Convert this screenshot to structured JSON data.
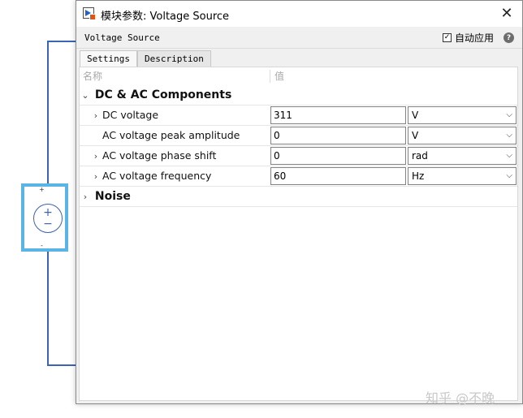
{
  "window": {
    "title": "模块参数: Voltage Source",
    "close_icon": "✕"
  },
  "block": {
    "name": "Voltage Source",
    "auto_apply_label": "自动应用",
    "auto_apply_checked": true
  },
  "tabs": [
    {
      "label": "Settings",
      "active": true
    },
    {
      "label": "Description",
      "active": false
    }
  ],
  "table": {
    "columns": {
      "name": "名称",
      "value": "值"
    },
    "groups": [
      {
        "label": "DC & AC Components",
        "expanded": true,
        "params": [
          {
            "label": "DC voltage",
            "expandable": true,
            "value": "311",
            "unit": "V"
          },
          {
            "label": "AC voltage peak amplitude",
            "expandable": false,
            "value": "0",
            "unit": "V"
          },
          {
            "label": "AC voltage phase shift",
            "expandable": true,
            "value": "0",
            "unit": "rad"
          },
          {
            "label": "AC voltage frequency",
            "expandable": true,
            "value": "60",
            "unit": "Hz"
          }
        ]
      },
      {
        "label": "Noise",
        "expanded": false
      }
    ]
  },
  "canvas": {
    "plus_sign": "+",
    "minus_sign": "−"
  },
  "watermark": "知乎 @不晚",
  "icons": {
    "help": "?",
    "check": "✓",
    "chevron_right": "›",
    "chevron_down": "⌄",
    "dropdown": "⌵"
  }
}
